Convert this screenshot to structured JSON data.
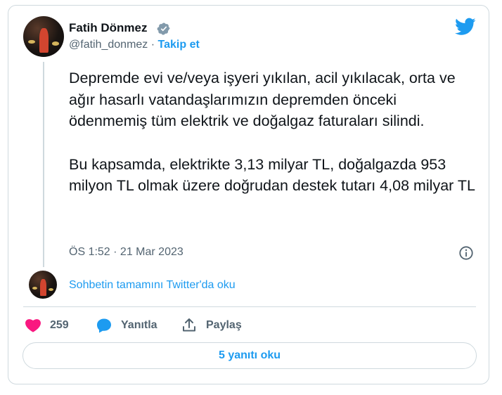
{
  "author": {
    "name": "Fatih Dönmez",
    "handle": "@fatih_donmez",
    "separator": " · ",
    "follow_label": "Takip et"
  },
  "tweet": {
    "paragraph_1": "Depremde evi ve/veya işyeri yıkılan, acil yıkılacak, orta ve ağır hasarlı vatandaşlarımızın depremden önceki ödenmemiş tüm elektrik ve doğalgaz faturaları silindi.",
    "paragraph_2": "Bu kapsamda, elektrikte 3,13 milyar TL, doğalgazda 953 milyon TL olmak üzere doğrudan destek tutarı 4,08 milyar TL",
    "timestamp": "ÖS 1:52 · 21 Mar 2023"
  },
  "conversation": {
    "read_label": "Sohbetin tamamını Twitter'da oku"
  },
  "actions": {
    "like_count": "259",
    "reply_label": "Yanıtla",
    "share_label": "Paylaş"
  },
  "replies_button": "5 yanıtı oku",
  "colors": {
    "accent": "#1d9bf0",
    "like": "#f91880",
    "muted": "#536471",
    "border": "#cfd9de"
  },
  "icons": [
    "verified-badge-icon",
    "twitter-bird-icon",
    "info-icon",
    "heart-icon",
    "reply-bubble-icon",
    "share-icon"
  ]
}
